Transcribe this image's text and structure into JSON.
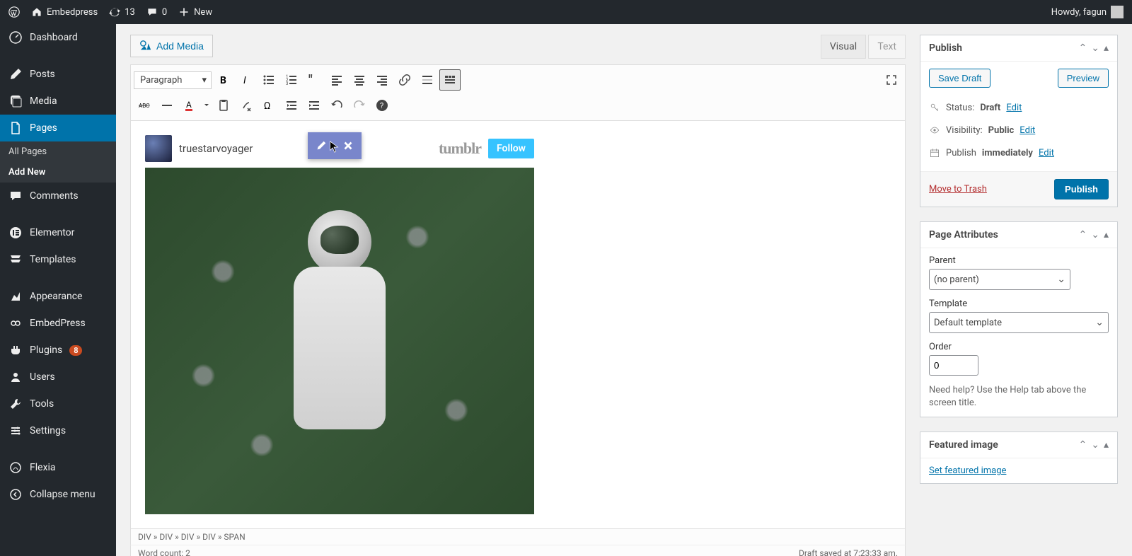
{
  "adminbar": {
    "site": "Embedpress",
    "updates": "13",
    "comments": "0",
    "newLabel": "New",
    "howdy": "Howdy, fagun"
  },
  "sidebar": {
    "dashboard": "Dashboard",
    "posts": "Posts",
    "media": "Media",
    "pages": "Pages",
    "allPages": "All Pages",
    "addNew": "Add New",
    "comments": "Comments",
    "elementor": "Elementor",
    "templates": "Templates",
    "appearance": "Appearance",
    "embedpress": "EmbedPress",
    "plugins": "Plugins",
    "pluginsBadge": "8",
    "users": "Users",
    "tools": "Tools",
    "settings": "Settings",
    "flexia": "Flexia",
    "collapse": "Collapse menu"
  },
  "editor": {
    "addMedia": "Add Media",
    "visualTab": "Visual",
    "textTab": "Text",
    "formatSelect": "Paragraph",
    "breadcrumb": "DIV » DIV » DIV » DIV » SPAN",
    "wordCount": "Word count: 2",
    "draftSaved": "Draft saved at 7:23:33 am."
  },
  "embed": {
    "user": "truestarvoyager",
    "platform": "tumblr",
    "follow": "Follow"
  },
  "publish": {
    "title": "Publish",
    "saveDraft": "Save Draft",
    "preview": "Preview",
    "statusLabel": "Status:",
    "statusValue": "Draft",
    "visibilityLabel": "Visibility:",
    "visibilityValue": "Public",
    "publishLabel": "Publish",
    "publishValue": "immediately",
    "edit": "Edit",
    "moveToTrash": "Move to Trash",
    "publishBtn": "Publish"
  },
  "pageAttr": {
    "title": "Page Attributes",
    "parentLabel": "Parent",
    "parentValue": "(no parent)",
    "templateLabel": "Template",
    "templateValue": "Default template",
    "orderLabel": "Order",
    "orderValue": "0",
    "helpText": "Need help? Use the Help tab above the screen title."
  },
  "featured": {
    "title": "Featured image",
    "setLink": "Set featured image"
  }
}
